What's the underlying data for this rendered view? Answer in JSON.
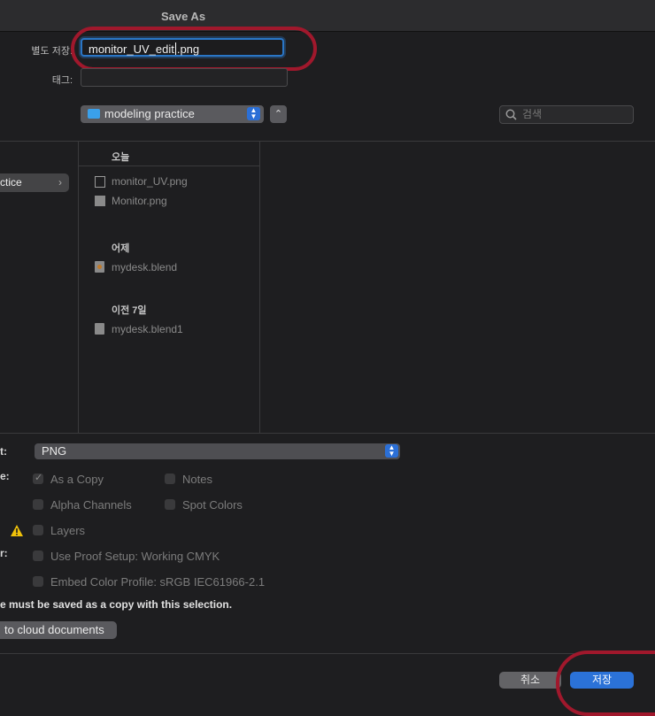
{
  "window": {
    "title": "Save As"
  },
  "form": {
    "save_as_label": "별도 저장:",
    "filename_value": "monitor_UV_edit.png",
    "filename_before_caret": "monitor_UV_edit",
    "filename_after_caret": ".png",
    "tags_label": "태그:",
    "tags_value": ""
  },
  "location": {
    "folder": "modeling practice",
    "up_glyph": "⌃",
    "search_placeholder": "검색"
  },
  "sidebar": {
    "selected_item": "ctice",
    "chevron": "›"
  },
  "browser": {
    "sections": [
      {
        "header": "오늘",
        "files": [
          "monitor_UV.png",
          "Monitor.png"
        ]
      },
      {
        "header": "어제",
        "files": [
          "mydesk.blend"
        ]
      },
      {
        "header": "이전 7일",
        "files": [
          "mydesk.blend1"
        ]
      }
    ]
  },
  "options": {
    "format_label": "t:",
    "format_value": "PNG",
    "save_label": "e:",
    "color_label": "r:",
    "as_a_copy": "As a Copy",
    "notes": "Notes",
    "alpha_channels": "Alpha Channels",
    "spot_colors": "Spot Colors",
    "layers": "Layers",
    "use_proof_setup": "Use Proof Setup:  Working CMYK",
    "embed_color_profile": "Embed Color Profile:  sRGB IEC61966-2.1",
    "warning_text": "e must be saved as a copy with this selection.",
    "cloud_button": "to cloud documents",
    "as_a_copy_checked": true,
    "warning_color": "#f0c20a"
  },
  "footer": {
    "cancel": "취소",
    "save": "저장",
    "accent": "#2b72d8"
  }
}
